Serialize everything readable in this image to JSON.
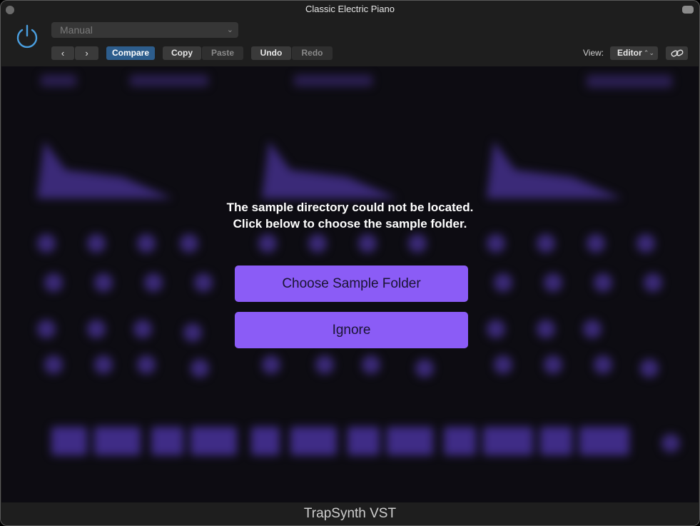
{
  "window": {
    "title": "Classic Electric Piano"
  },
  "toolbar": {
    "preset_value": "Manual",
    "prev_icon": "‹",
    "next_icon": "›",
    "compare_label": "Compare",
    "copy_label": "Copy",
    "paste_label": "Paste",
    "undo_label": "Undo",
    "redo_label": "Redo",
    "view_label": "View:",
    "view_value": "Editor"
  },
  "dialog": {
    "message_line1": "The sample directory could not be located.",
    "message_line2": "Click below to choose the sample folder.",
    "choose_label": "Choose Sample Folder",
    "ignore_label": "Ignore"
  },
  "footer": {
    "product_name": "TrapSynth VST"
  },
  "colors": {
    "accent_purple": "#8b5cf6",
    "compare_blue": "#2d5d8c",
    "power_blue": "#4a9fe0"
  }
}
